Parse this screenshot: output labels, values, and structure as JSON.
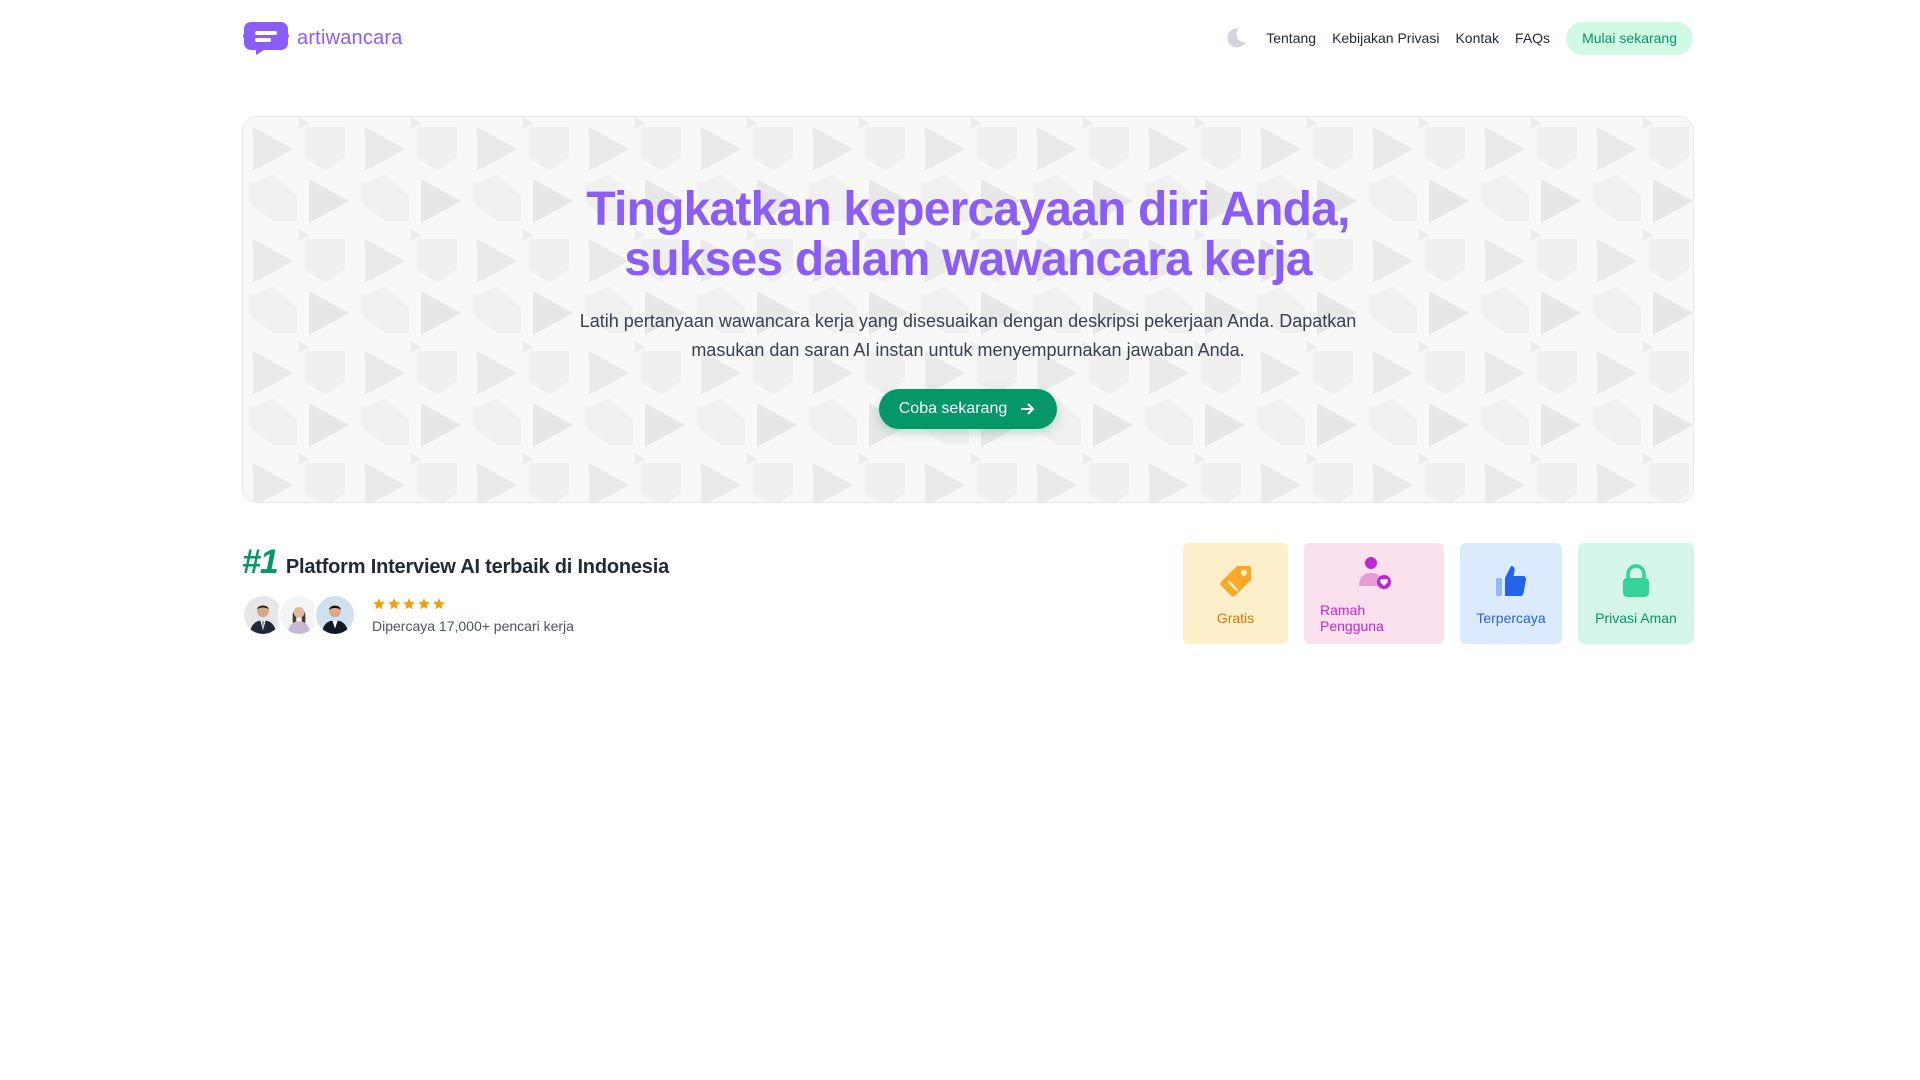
{
  "header": {
    "brand_name": "artiwancara",
    "logo_icon": "chat-bubble-logo-icon",
    "theme_toggle_icon": "moon-icon",
    "nav": [
      {
        "label": "Tentang"
      },
      {
        "label": "Kebijakan Privasi"
      },
      {
        "label": "Kontak"
      },
      {
        "label": "FAQs"
      }
    ],
    "cta_label": "Mulai sekarang"
  },
  "hero": {
    "title_line1": "Tingkatkan kepercayaan diri Anda,",
    "title_line2": "sukses dalam wawancara kerja",
    "subtitle_line1": "Latih pertanyaan wawancara kerja yang disesuaikan dengan deskripsi pekerjaan Anda. Dapatkan",
    "subtitle_line2": "masukan dan saran AI instan untuk menyempurnakan jawaban Anda.",
    "cta_label": "Coba sekarang",
    "cta_icon": "arrow-right-icon"
  },
  "trust": {
    "rank": "#1",
    "headline": "Platform Interview AI terbaik di Indonesia",
    "rating_stars": 5,
    "rating_text": "Dipercaya 17,000+ pencari kerja"
  },
  "features": [
    {
      "label": "Gratis",
      "icon": "tag-icon",
      "color": "#d97706",
      "bg": "#fdefc9"
    },
    {
      "label": "Ramah Pengguna",
      "icon": "user-heart-icon",
      "color": "#c026d3",
      "bg": "#fbe0ee"
    },
    {
      "label": "Terpercaya",
      "icon": "thumbs-up-icon",
      "color": "#2563eb",
      "bg": "#dbeafe"
    },
    {
      "label": "Privasi Aman",
      "icon": "lock-icon",
      "color": "#059669",
      "bg": "#d5f5e8"
    }
  ],
  "colors": {
    "brand_purple": "#8b5cf6",
    "brand_green": "#059669",
    "star_orange": "#f59e0b"
  }
}
